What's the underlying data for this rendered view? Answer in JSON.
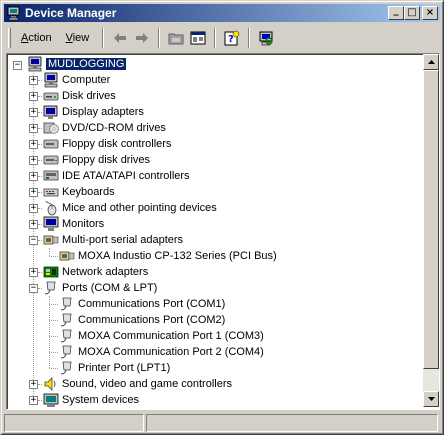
{
  "window": {
    "title": "Device Manager",
    "controls": {
      "minimize": "_",
      "maximize": "□",
      "close": "×"
    }
  },
  "toolbar": {
    "menus": [
      {
        "label": "Action",
        "accel": "A",
        "rest": "ction"
      },
      {
        "label": "View",
        "accel": "V",
        "rest": "iew"
      }
    ],
    "tools": [
      "back-icon",
      "forward-icon",
      "up-folder-icon",
      "properties-icon",
      "help-icon",
      "computer-scan-icon"
    ]
  },
  "tree": {
    "root": {
      "label": "MUDLOGGING",
      "icon": "computer-icon",
      "expanded": true,
      "selected": true
    },
    "items": [
      {
        "label": "Computer",
        "icon": "computer-icon",
        "expanded": false,
        "level": 1
      },
      {
        "label": "Disk drives",
        "icon": "disk-drive-icon",
        "expanded": false,
        "level": 1
      },
      {
        "label": "Display adapters",
        "icon": "display-adapter-icon",
        "expanded": false,
        "level": 1
      },
      {
        "label": "DVD/CD-ROM drives",
        "icon": "cdrom-icon",
        "expanded": false,
        "level": 1
      },
      {
        "label": "Floppy disk controllers",
        "icon": "floppy-controller-icon",
        "expanded": false,
        "level": 1
      },
      {
        "label": "Floppy disk drives",
        "icon": "floppy-drive-icon",
        "expanded": false,
        "level": 1
      },
      {
        "label": "IDE ATA/ATAPI controllers",
        "icon": "ide-controller-icon",
        "expanded": false,
        "level": 1
      },
      {
        "label": "Keyboards",
        "icon": "keyboard-icon",
        "expanded": false,
        "level": 1
      },
      {
        "label": "Mice and other pointing devices",
        "icon": "mouse-icon",
        "expanded": false,
        "level": 1
      },
      {
        "label": "Monitors",
        "icon": "monitor-icon",
        "expanded": false,
        "level": 1
      },
      {
        "label": "Multi-port serial adapters",
        "icon": "serial-adapter-icon",
        "expanded": true,
        "level": 1
      },
      {
        "label": "MOXA Industio CP-132 Series (PCI Bus)",
        "icon": "serial-adapter-icon",
        "level": 2
      },
      {
        "label": "Network adapters",
        "icon": "network-adapter-icon",
        "expanded": false,
        "level": 1
      },
      {
        "label": "Ports (COM & LPT)",
        "icon": "port-icon",
        "expanded": true,
        "level": 1
      },
      {
        "label": "Communications Port (COM1)",
        "icon": "port-icon",
        "level": 2
      },
      {
        "label": "Communications Port (COM2)",
        "icon": "port-icon",
        "level": 2
      },
      {
        "label": "MOXA Communication Port 1 (COM3)",
        "icon": "port-icon",
        "level": 2
      },
      {
        "label": "MOXA Communication Port 2 (COM4)",
        "icon": "port-icon",
        "level": 2
      },
      {
        "label": "Printer Port (LPT1)",
        "icon": "port-icon",
        "level": 2
      },
      {
        "label": "Sound, video and game controllers",
        "icon": "sound-icon",
        "expanded": false,
        "level": 1
      },
      {
        "label": "System devices",
        "icon": "system-devices-icon",
        "expanded": false,
        "level": 1
      }
    ]
  },
  "colors": {
    "titlebar_start": "#0a246a",
    "titlebar_end": "#a6caf0",
    "selection": "#0a246a",
    "face": "#d4d0c8"
  }
}
